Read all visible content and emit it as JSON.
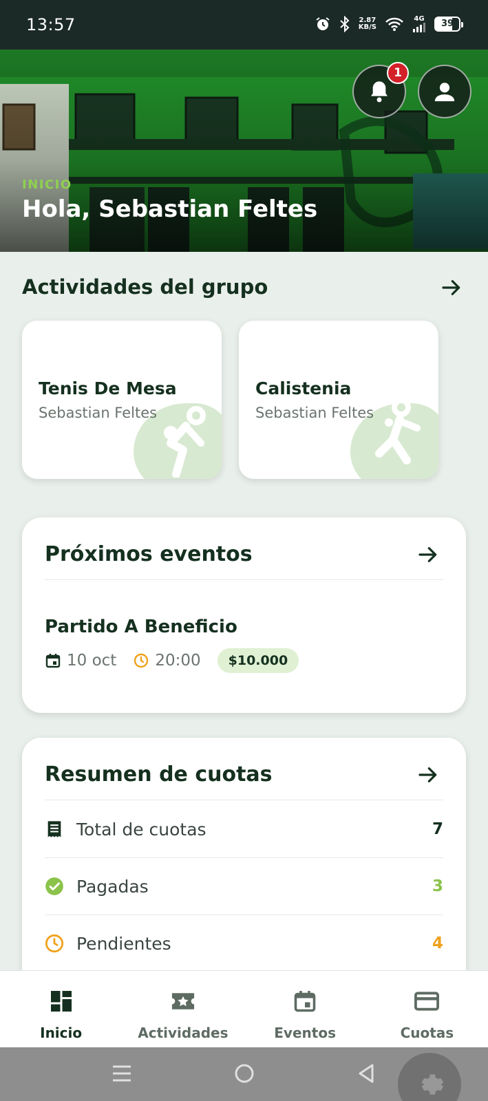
{
  "status_bar": {
    "time": "13:57",
    "net_speed_value": "2.87",
    "net_speed_unit": "KB/S",
    "network": "4G",
    "battery": "39"
  },
  "hero": {
    "section_label": "INICIO",
    "greeting": "Hola, Sebastian Feltes",
    "notification_count": "1"
  },
  "activities": {
    "header": "Actividades del grupo",
    "items": [
      {
        "name": "Tenis De Mesa",
        "member": "Sebastian Feltes",
        "icon": "table-tennis-icon"
      },
      {
        "name": "Calistenia",
        "member": "Sebastian Feltes",
        "icon": "calisthenics-icon"
      }
    ]
  },
  "events": {
    "header": "Próximos eventos",
    "items": [
      {
        "name": "Partido A Beneficio",
        "date": "10 oct",
        "time": "20:00",
        "price": "$10.000"
      }
    ]
  },
  "fees": {
    "header": "Resumen de cuotas",
    "rows": [
      {
        "label": "Total de cuotas",
        "value": "7",
        "icon": "receipt-icon",
        "color": "#15301f"
      },
      {
        "label": "Pagadas",
        "value": "3",
        "icon": "check-circle-icon",
        "color": "#8bc34a"
      },
      {
        "label": "Pendientes",
        "value": "4",
        "icon": "clock-icon",
        "color": "#f0a21c"
      }
    ]
  },
  "bottom_nav": {
    "items": [
      {
        "label": "Inicio",
        "icon": "dashboard-icon",
        "active": true
      },
      {
        "label": "Actividades",
        "icon": "star-ticket-icon",
        "active": false
      },
      {
        "label": "Eventos",
        "icon": "calendar-icon",
        "active": false
      },
      {
        "label": "Cuotas",
        "icon": "credit-card-icon",
        "active": false
      }
    ]
  },
  "colors": {
    "primary_dark": "#15301f",
    "accent_green": "#8fd14f",
    "pending_orange": "#f0a21c",
    "badge_red": "#d32029"
  }
}
